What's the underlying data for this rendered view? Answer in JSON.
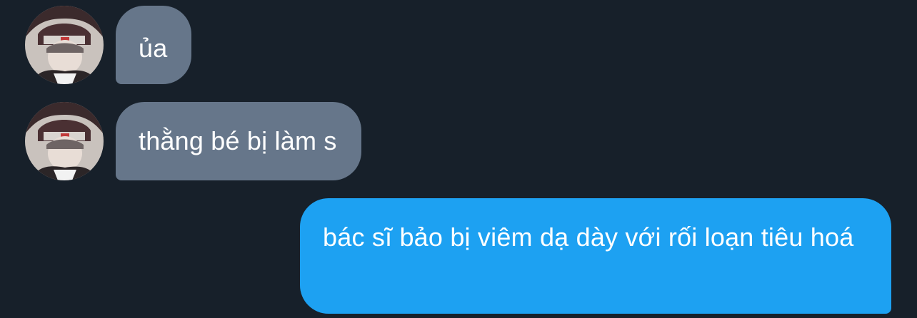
{
  "conversation": {
    "messages": [
      {
        "direction": "received",
        "avatar_icon": "contact-avatar",
        "text": "ủa"
      },
      {
        "direction": "received",
        "avatar_icon": "contact-avatar",
        "text": "thằng bé bị làm s"
      },
      {
        "direction": "sent",
        "text": "bác sĩ bảo bị viêm dạ dày với rối loạn tiêu hoá"
      }
    ]
  },
  "colors": {
    "background": "#17202a",
    "received_bubble": "#66768a",
    "sent_bubble": "#1da1f2",
    "text": "#ffffff"
  }
}
